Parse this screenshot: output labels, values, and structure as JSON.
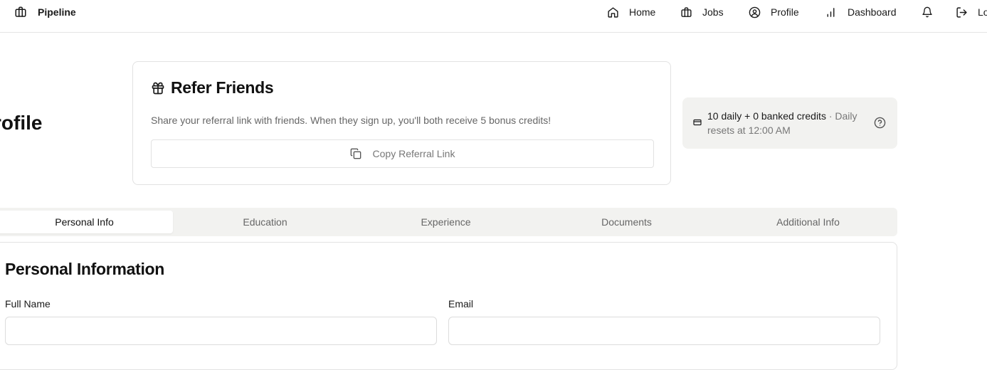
{
  "nav": {
    "brand": "Pipeline",
    "items": [
      {
        "label": "Home",
        "icon": "home-icon"
      },
      {
        "label": "Jobs",
        "icon": "briefcase-icon"
      },
      {
        "label": "Profile",
        "icon": "user-circle-icon"
      },
      {
        "label": "Dashboard",
        "icon": "bar-chart-icon"
      },
      {
        "label": "",
        "icon": "bell-icon"
      },
      {
        "label": "Lo",
        "icon": "logout-icon"
      }
    ]
  },
  "page": {
    "heading": "rofile"
  },
  "referral": {
    "title": "Refer Friends",
    "description": "Share your referral link with friends. When they sign up, you'll both receive 5 bonus credits!",
    "button_label": "Copy Referral Link"
  },
  "credits": {
    "strong": "10 daily + 0 banked credits",
    "rest": " · Daily resets at 12:00 AM"
  },
  "tabs": [
    {
      "label": "Personal Info",
      "active": true
    },
    {
      "label": "Education",
      "active": false
    },
    {
      "label": "Experience",
      "active": false
    },
    {
      "label": "Documents",
      "active": false
    },
    {
      "label": "Additional Info",
      "active": false
    }
  ],
  "form": {
    "title": "Personal Information",
    "fields": [
      {
        "label": "Full Name",
        "value": "",
        "placeholder": ""
      },
      {
        "label": "Email",
        "value": "",
        "placeholder": ""
      }
    ]
  },
  "colors": {
    "border": "#e2e2e2",
    "muted_bg": "#f2f2f0",
    "text": "#1a1a1a",
    "muted_text": "#666666"
  }
}
